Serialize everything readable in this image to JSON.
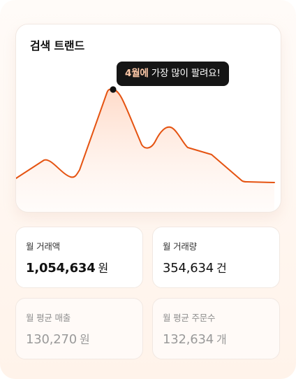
{
  "trend": {
    "title": "검색 트랜드",
    "tooltip": {
      "highlight": "4월에",
      "text": " 가장 많이 팔려요!"
    },
    "line_color": "#e55311",
    "fill_color": "#ffe6d8"
  },
  "stats": [
    {
      "label": "월 거래액",
      "value": "1,054,634",
      "unit": "원"
    },
    {
      "label": "월 거래량",
      "value": "354,634",
      "unit": "건"
    },
    {
      "label": "월 평균 매출",
      "value": "130,270",
      "unit": "원"
    },
    {
      "label": "월 평균 주문수",
      "value": "132,634",
      "unit": "개"
    }
  ]
}
